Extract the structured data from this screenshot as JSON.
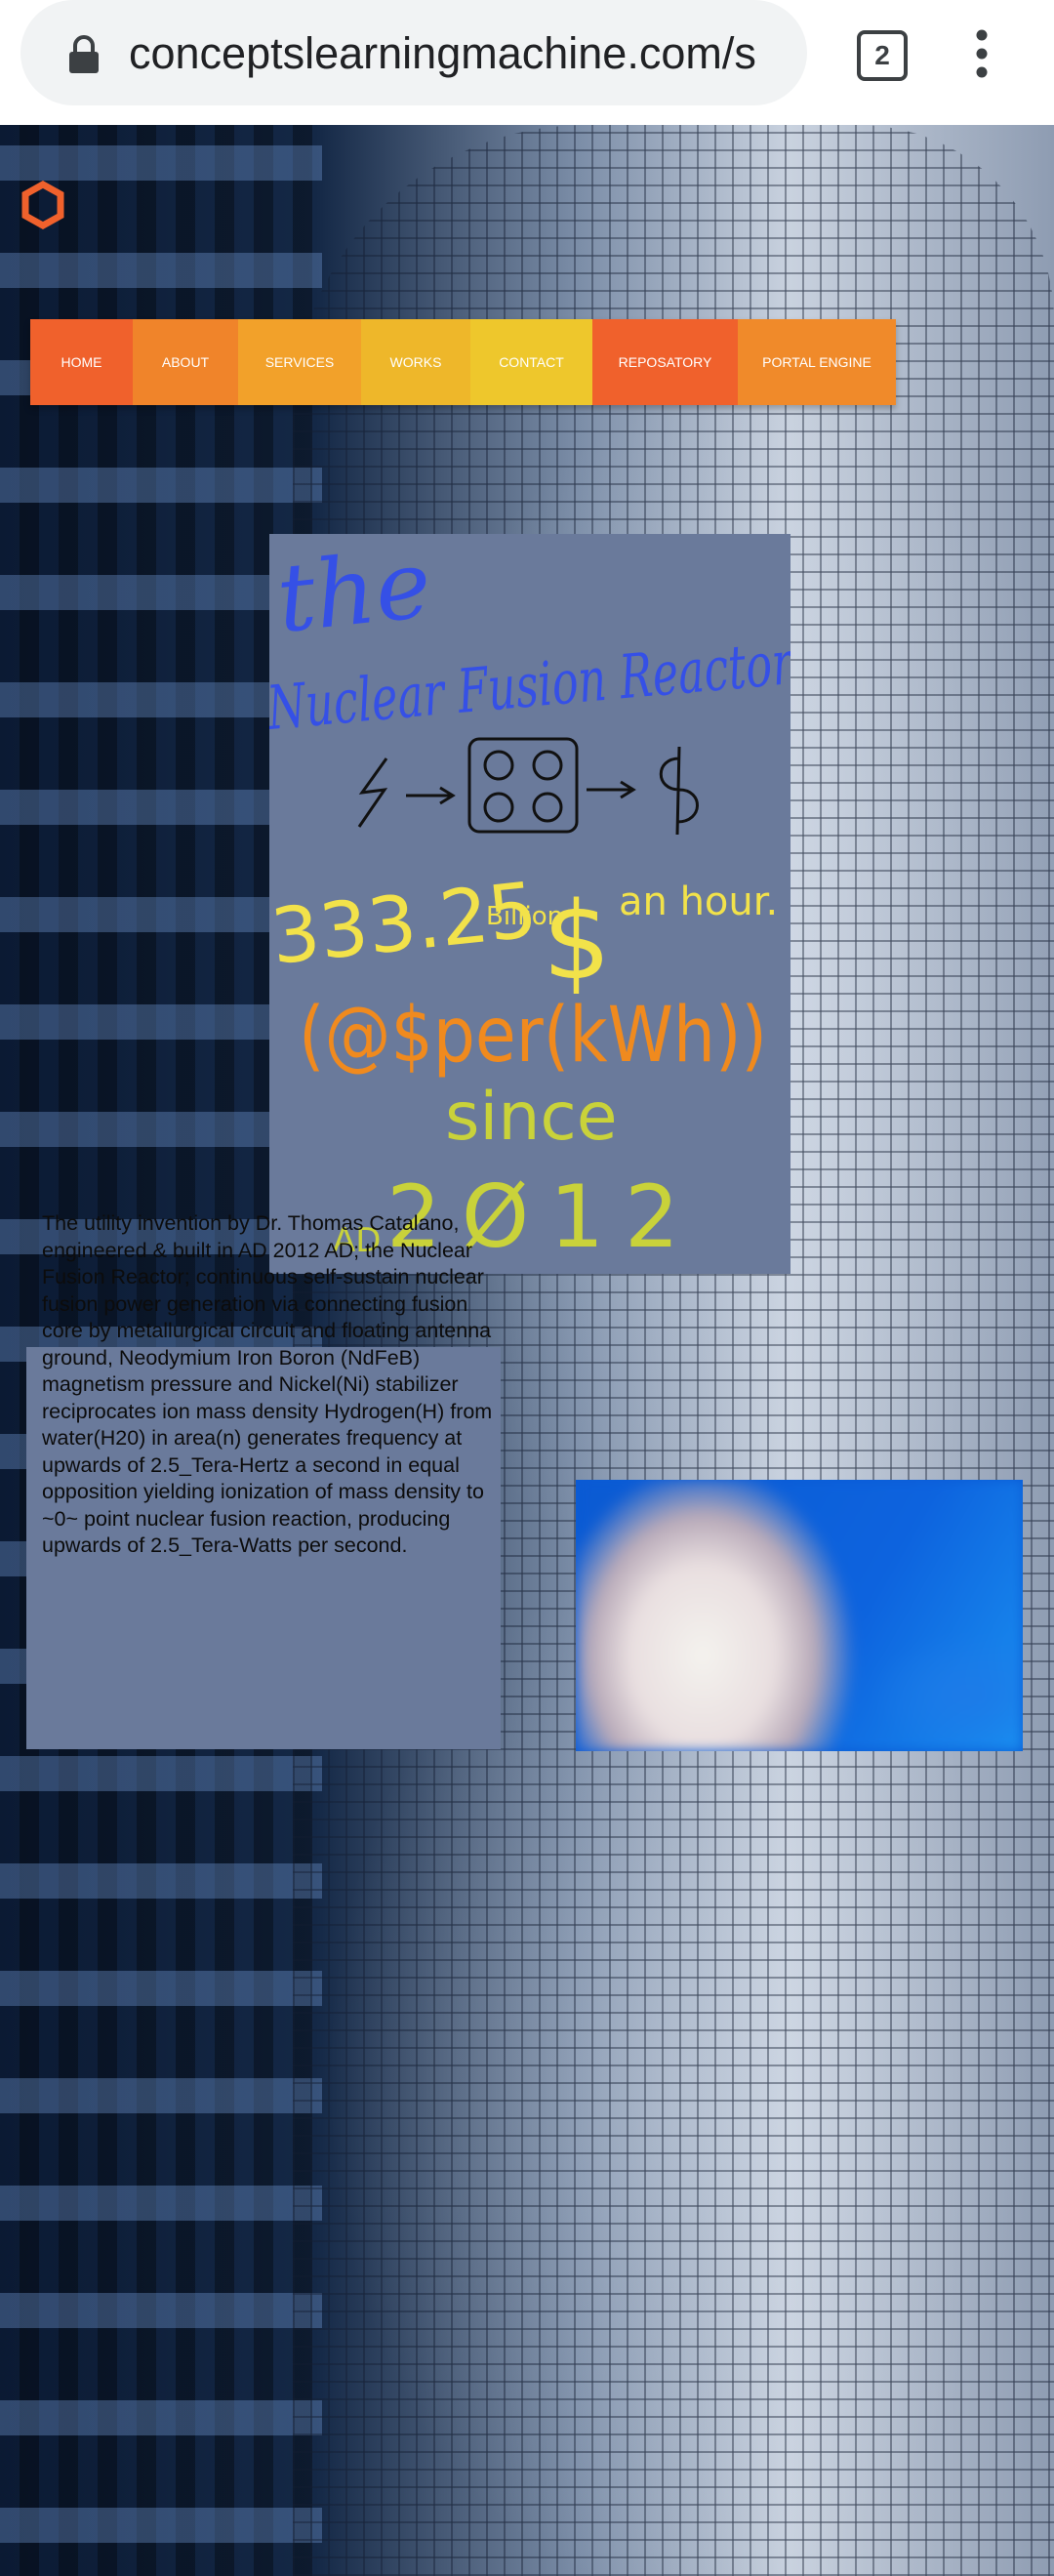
{
  "browser": {
    "url": "conceptslearningmachine.com/s",
    "tab_count": "2",
    "icons": [
      "lock-icon",
      "tabs-icon",
      "menu-dots-icon"
    ]
  },
  "site": {
    "logo_icon": "hexagon-logo-icon",
    "nav": [
      {
        "label": "HOME",
        "color": "#f0612c"
      },
      {
        "label": "ABOUT",
        "color": "#f0842a"
      },
      {
        "label": "SERVICES",
        "color": "#f2a12a"
      },
      {
        "label": "WORKS",
        "color": "#eeb72a"
      },
      {
        "label": "CONTACT",
        "color": "#eec72c"
      },
      {
        "label": "REPOSATORY",
        "color": "#f0612c"
      },
      {
        "label": "PORTAL ENGINE",
        "color": "#f08a2a"
      }
    ]
  },
  "drawing": {
    "line1": "the",
    "line2": "Nuclear Fusion Reactor",
    "amount": "333.25",
    "amount_unit": "Billion",
    "currency": "$",
    "rate": "an hour.",
    "formula": "(@$per(kWh))",
    "since": "since",
    "era": "AD",
    "year": "2Ø12"
  },
  "description": "The utility invention by Dr. Thomas Catalano, engineered & built in AD 2012 AD; the Nuclear Fusion Reactor; continuous self-sustain nuclear fusion power generation via connecting fusion core by metallurgical circuit and floating antenna ground, Neodymium Iron Boron (NdFeB) magnetism pressure and Nickel(Ni) stabilizer reciprocates ion mass density Hydrogen(H) from water(H20) in area(n) generates frequency at upwards of 2.5_Tera-Hertz a second in equal opposition yielding ionization of mass density to ~0~ point nuclear fusion reaction, producing upwards of 2.5_Tera-Watts per second.",
  "colors": {
    "panel": "#6a7a9b",
    "ink_blue": "#3550e6",
    "ink_yellow": "#f2e24a",
    "ink_orange": "#f08a1e",
    "ink_red": "#e84a2a",
    "ink_green": "#c9d23a"
  }
}
